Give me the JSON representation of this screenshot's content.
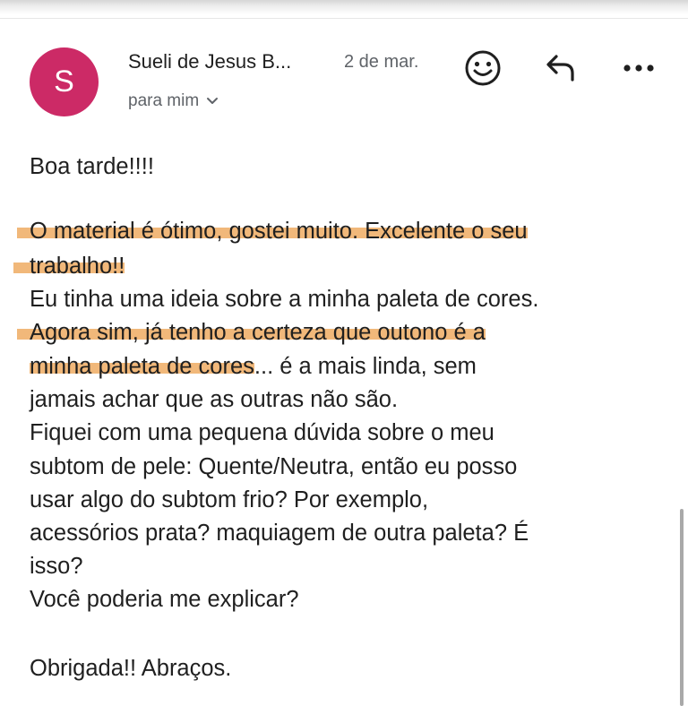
{
  "email": {
    "sender": {
      "initial": "S",
      "name": "Sueli de Jesus B...",
      "avatar_color": "#cc2a66"
    },
    "date": "2 de mar.",
    "recipient": "para mim",
    "actions": {
      "emoji_icon": "emoji-smile-icon",
      "reply_icon": "reply-icon",
      "more_icon": "more-horizontal-icon"
    },
    "highlight_color": "#f1b87a",
    "body": {
      "greeting": "Boa tarde!!!!",
      "p1_l1": "O material é ótimo, gostei muito. Excelente o seu",
      "p1_l2": "trabalho!!",
      "p1_l3": "Eu tinha uma ideia sobre a minha paleta de cores.",
      "p1_l4": "Agora sim, já tenho a certeza que outono é a",
      "p1_l5_hl": "minha  paleta de cores",
      "p1_l5_rest": "... é a mais linda, sem",
      "p1_l6": "jamais achar que as outras não são.",
      "p1_l7": "Fiquei com uma pequena dúvida sobre o meu",
      "p1_l8": "subtom de pele: Quente/Neutra, então eu  posso",
      "p1_l9": "usar algo do subtom frio? Por exemplo,",
      "p1_l10": "acessórios prata? maquiagem de outra paleta? É",
      "p1_l11": "isso?",
      "p1_l12": "Você poderia me explicar?",
      "closing": "Obrigada!!  Abraços."
    }
  }
}
